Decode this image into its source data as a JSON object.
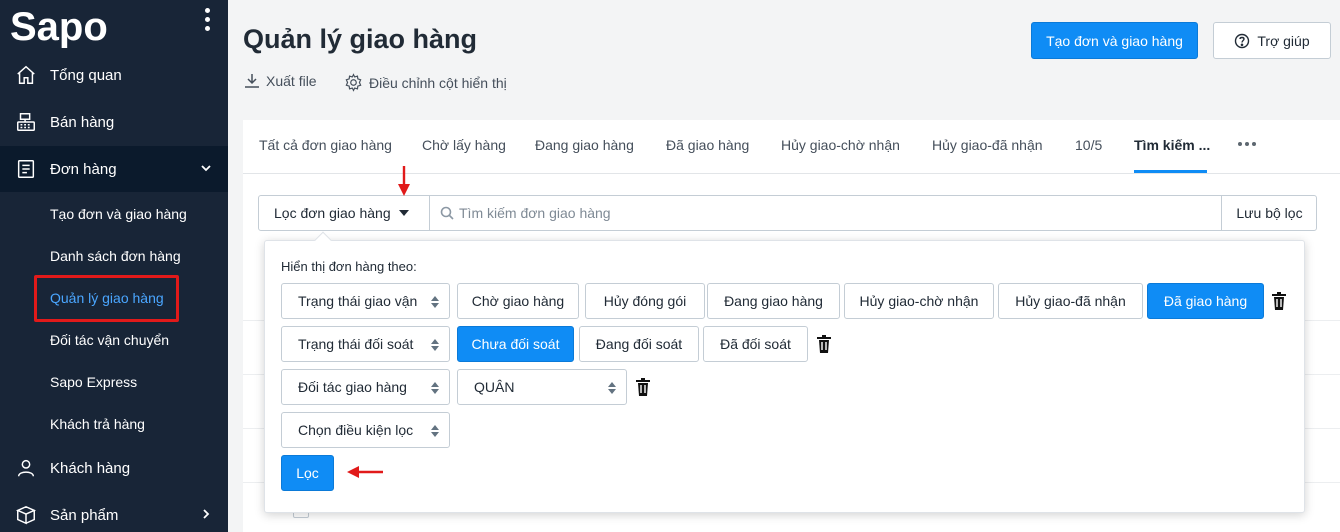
{
  "app": {
    "brand": "Sapo"
  },
  "sidebar": {
    "items": [
      {
        "label": "Tổng quan",
        "icon": "home-icon"
      },
      {
        "label": "Bán hàng",
        "icon": "cash-register-icon"
      },
      {
        "label": "Đơn hàng",
        "icon": "order-icon",
        "expanded": true
      },
      {
        "label": "Khách hàng",
        "icon": "user-icon"
      },
      {
        "label": "Sản phẩm",
        "icon": "box-icon"
      }
    ],
    "sub_items": [
      {
        "label": "Tạo đơn và giao hàng"
      },
      {
        "label": "Danh sách đơn hàng"
      },
      {
        "label": "Quản lý giao hàng",
        "active": true
      },
      {
        "label": "Đối tác vận chuyển"
      },
      {
        "label": "Sapo Express"
      },
      {
        "label": "Khách trả hàng"
      }
    ]
  },
  "header": {
    "title": "Quản lý giao hàng",
    "export_label": "Xuất file",
    "columns_label": "Điều chỉnh cột hiển thị",
    "create_button": "Tạo đơn và giao hàng",
    "help_button": "Trợ giúp"
  },
  "tabs": [
    {
      "label": "Tất cả đơn giao hàng"
    },
    {
      "label": "Chờ lấy hàng"
    },
    {
      "label": "Đang giao hàng"
    },
    {
      "label": "Đã giao hàng"
    },
    {
      "label": "Hủy giao-chờ nhận"
    },
    {
      "label": "Hủy giao-đã nhận"
    },
    {
      "label": "10/5"
    },
    {
      "label": "Tìm kiếm ...",
      "active": true
    }
  ],
  "filter": {
    "button_label": "Lọc đơn giao hàng",
    "search_placeholder": "Tìm kiếm đơn giao hàng",
    "save_label": "Lưu bộ lọc"
  },
  "dropdown": {
    "heading": "Hiển thị đơn hàng theo:",
    "rows": [
      {
        "select": "Trạng thái giao vận",
        "chips": [
          {
            "label": "Chờ giao hàng",
            "selected": false
          },
          {
            "label": "Hủy đóng gói",
            "selected": false
          },
          {
            "label": "Đang giao hàng",
            "selected": false
          },
          {
            "label": "Hủy giao-chờ nhận",
            "selected": false
          },
          {
            "label": "Hủy giao-đã nhận",
            "selected": false
          },
          {
            "label": "Đã giao hàng",
            "selected": true
          }
        ]
      },
      {
        "select": "Trạng thái đối soát",
        "chips": [
          {
            "label": "Chưa đối soát",
            "selected": true
          },
          {
            "label": "Đang đối soát",
            "selected": false
          },
          {
            "label": "Đã đối soát",
            "selected": false
          }
        ]
      },
      {
        "select": "Đối tác giao hàng",
        "value_select": "QUÂN"
      },
      {
        "select": "Chọn điều kiện lọc"
      }
    ],
    "apply_label": "Lọc"
  },
  "colors": {
    "sidebar_bg": "#182537",
    "primary": "#0f8cf5",
    "active_link": "#4aa6ff",
    "annotation_red": "#e11a1a"
  }
}
